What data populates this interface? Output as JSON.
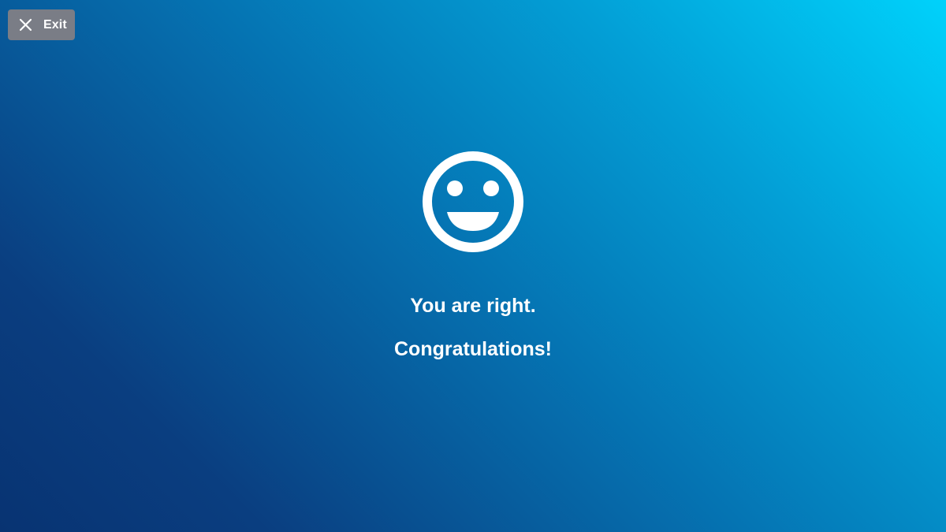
{
  "header": {
    "exit_label": "Exit",
    "exit_icon": "close-icon"
  },
  "result": {
    "icon": "smiley-face-icon",
    "line1": "You are right.",
    "line2": "Congratulations!"
  },
  "colors": {
    "background_dark": "#083372",
    "background_light": "#00d2fb",
    "exit_button_bg": "#7a7d86",
    "text": "#ffffff"
  }
}
